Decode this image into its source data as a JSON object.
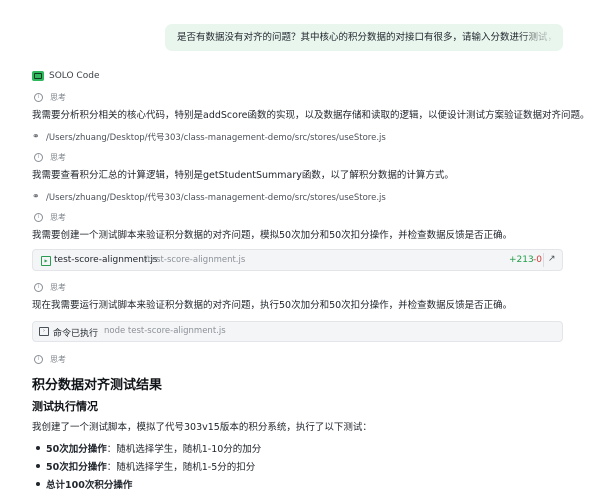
{
  "user_message": {
    "text": "是否有数据没有对齐的问题？其中核心的积分数据的对接口有很多，请输入分数进行测试，加和减"
  },
  "agent": {
    "name": "SOLO Code"
  },
  "steps": [
    {
      "think_label": "思考",
      "text": "我需要分析积分相关的核心代码，特别是addScore函数的实现，以及数据存储和读取的逻辑，以便设计测试方案验证数据对齐问题。",
      "file_ref": "/Users/zhuang/Desktop/代号303/class-management-demo/src/stores/useStore.js"
    },
    {
      "think_label": "思考",
      "text": "我需要查看积分汇总的计算逻辑，特别是getStudentSummary函数，以了解积分数据的计算方式。",
      "file_ref": "/Users/zhuang/Desktop/代号303/class-management-demo/src/stores/useStore.js"
    },
    {
      "think_label": "思考",
      "text": "我需要创建一个测试脚本来验证积分数据的对齐问题，模拟50次加分和50次扣分操作，并检查数据反馈是否正确。"
    },
    {
      "think_label": "思考",
      "text": "现在我需要运行测试脚本来验证积分数据的对齐问题，执行50次加分和50次扣分操作，并检查数据反馈是否正确。"
    },
    {
      "think_label": "思考"
    }
  ],
  "file_card": {
    "name": "test-score-alignment.js",
    "path": "./test-score-alignment.js",
    "additions": "+213",
    "deletions": "-0"
  },
  "command_card": {
    "label": "命令已执行",
    "command": "node test-score-alignment.js"
  },
  "result": {
    "title": "积分数据对齐测试结果",
    "subtitle": "测试执行情况",
    "intro": "我创建了一个测试脚本，模拟了代号303v15版本的积分系统，执行了以下测试：",
    "bullets": [
      {
        "bold": "50次加分操作",
        "rest": "：随机选择学生，随机1-10分的加分"
      },
      {
        "bold": "50次扣分操作",
        "rest": "：随机选择学生，随机1-5分的扣分"
      },
      {
        "bold": "总计100次积分操作",
        "rest": ""
      }
    ]
  },
  "colors": {
    "bubble_bg": "#e9f6ee",
    "brand_green": "#2fb85d",
    "diff_add": "#1f9d48",
    "diff_del": "#d13b3b"
  },
  "icons": [
    "lightbulb-icon",
    "link-icon",
    "file-code-icon",
    "open-external-icon",
    "terminal-icon",
    "solo-logo-icon"
  ]
}
